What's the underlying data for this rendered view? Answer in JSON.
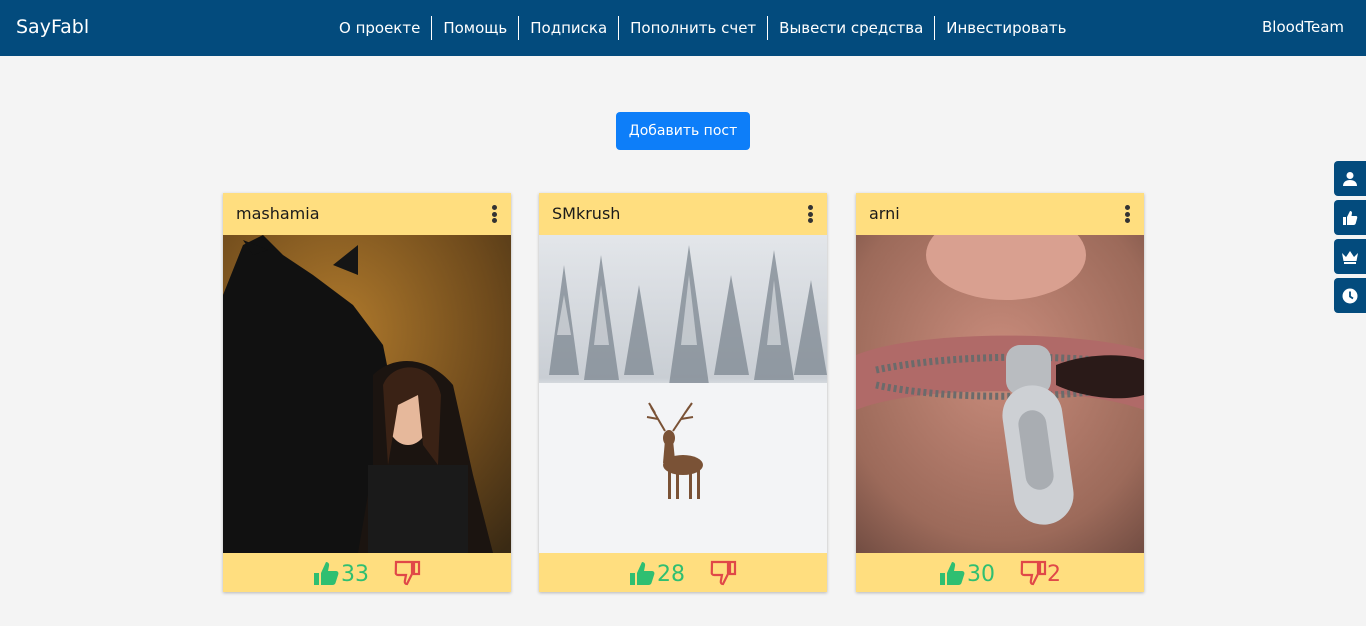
{
  "header": {
    "brand": "SayFabl",
    "nav": [
      "О проекте",
      "Помощь",
      "Подписка",
      "Пополнить счет",
      "Вывести средства",
      "Инвестировать"
    ],
    "user": "BloodTeam"
  },
  "main": {
    "add_post_label": "Добавить пост"
  },
  "side_tools": [
    "user-icon",
    "thumbs-up-icon",
    "crown-icon",
    "clock-icon"
  ],
  "colors": {
    "header": "#034b7d",
    "card": "#ffde7f",
    "button": "#0d7ef9",
    "like": "#2fbf71",
    "dislike": "#e04848"
  },
  "posts": [
    {
      "author": "mashamia",
      "image": "woman-with-black-horse-photo",
      "likes": "33",
      "dislikes": ""
    },
    {
      "author": "SMkrush",
      "image": "deer-in-snowy-forest-photo",
      "likes": "28",
      "dislikes": ""
    },
    {
      "author": "arni",
      "image": "zipper-mouth-photo",
      "likes": "30",
      "dislikes": "2"
    }
  ]
}
